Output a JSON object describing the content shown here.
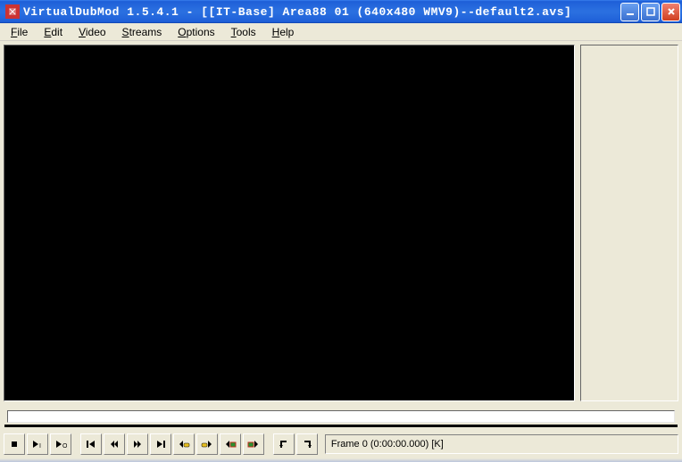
{
  "window": {
    "title": "VirtualDubMod 1.5.4.1 - [[IT-Base] Area88 01 (640x480 WMV9)--default2.avs]"
  },
  "menu": {
    "file": {
      "label": "File",
      "accel": "F"
    },
    "edit": {
      "label": "Edit",
      "accel": "E"
    },
    "video": {
      "label": "Video",
      "accel": "V"
    },
    "streams": {
      "label": "Streams",
      "accel": "S"
    },
    "options": {
      "label": "Options",
      "accel": "O"
    },
    "tools": {
      "label": "Tools",
      "accel": "T"
    },
    "help": {
      "label": "Help",
      "accel": "H"
    }
  },
  "status": {
    "frame_text": "Frame 0 (0:00:00.000) [K]"
  },
  "icons": {
    "stop": "stop",
    "play_input": "play-input",
    "play_output": "play-output",
    "go_start": "go-start",
    "step_back": "step-back",
    "step_fwd": "step-forward",
    "go_end": "go-end",
    "key_prev": "key-prev",
    "key_next": "key-next",
    "scene_prev": "scene-prev",
    "scene_next": "scene-next",
    "mark_in": "mark-in",
    "mark_out": "mark-out"
  }
}
